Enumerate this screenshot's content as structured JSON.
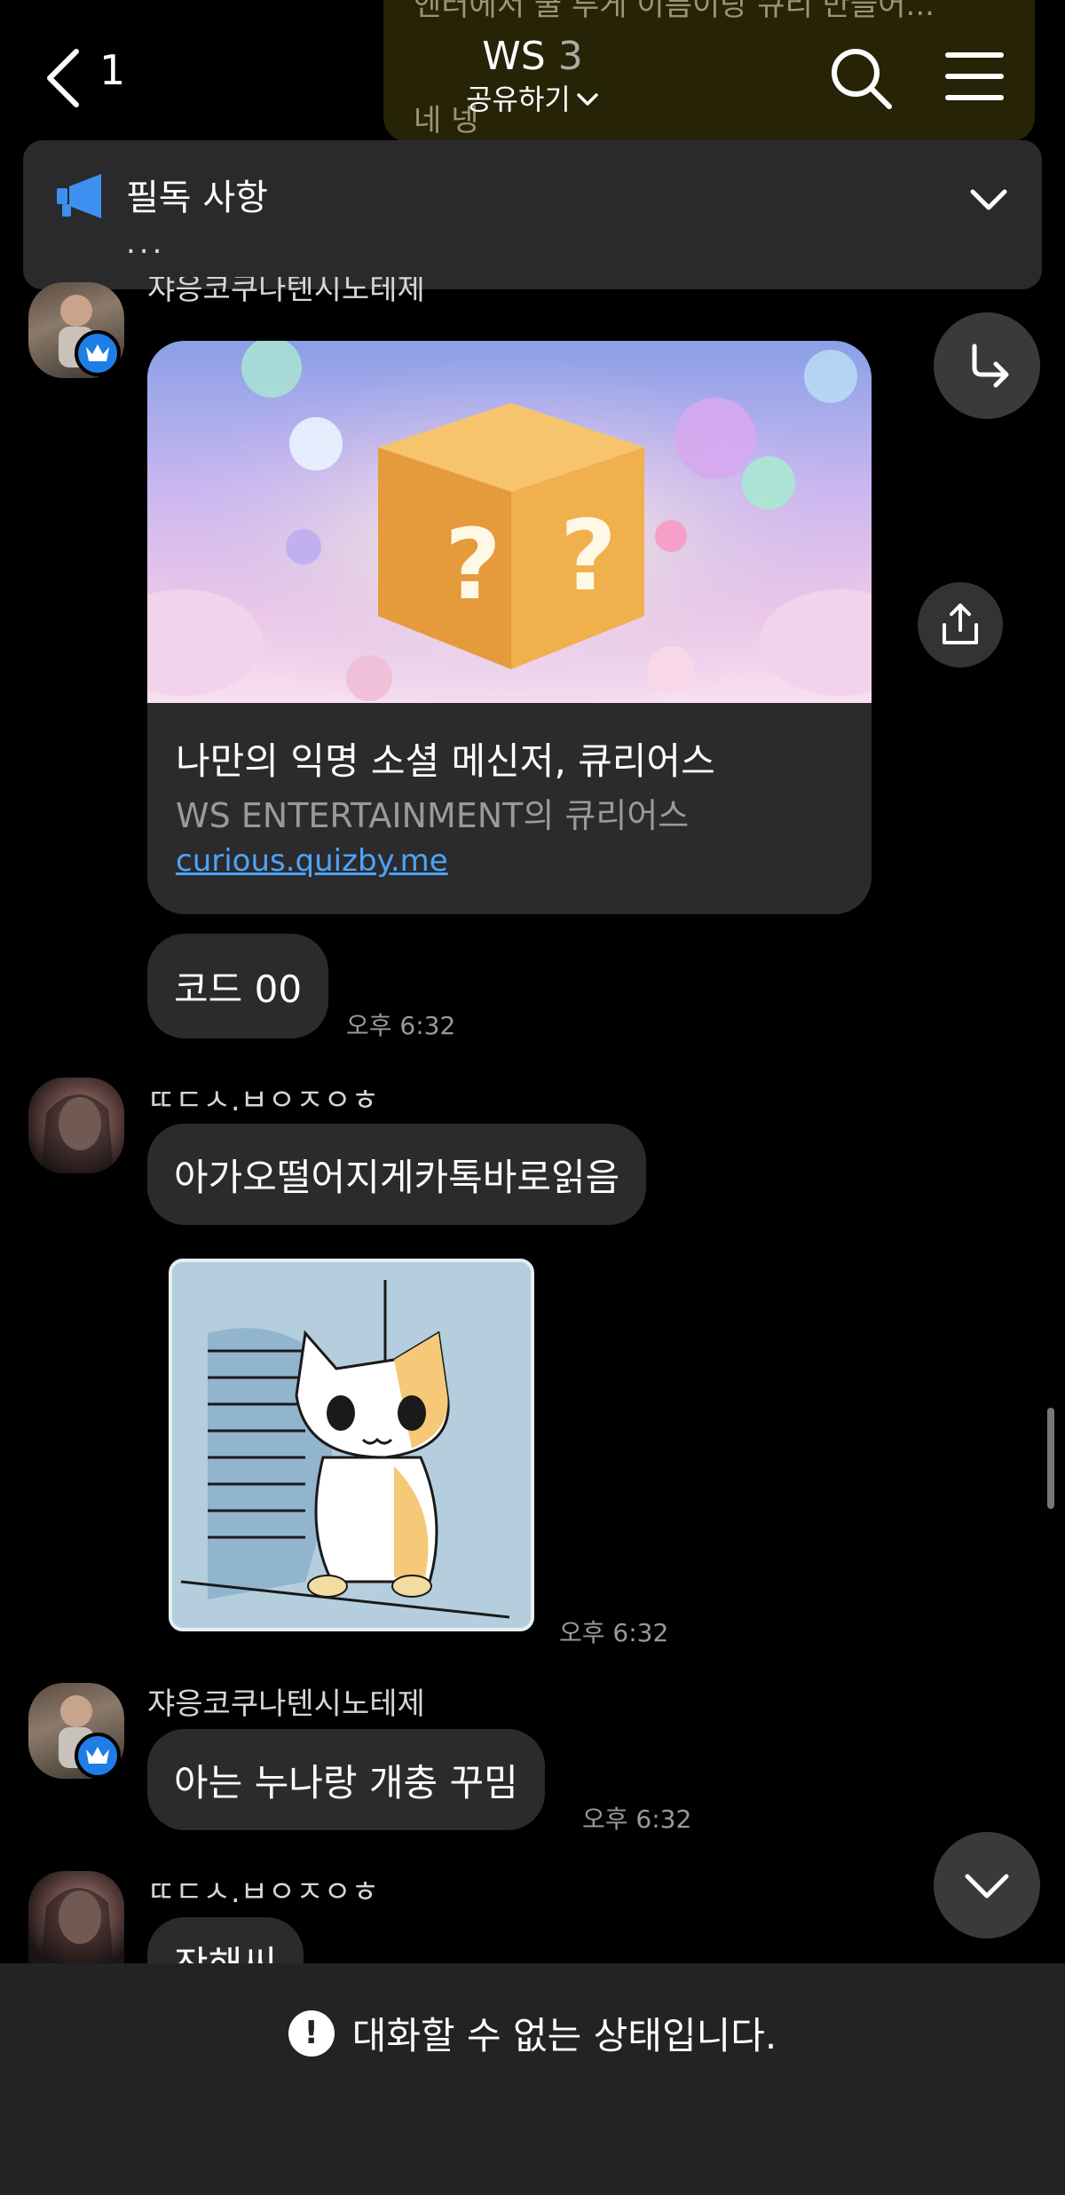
{
  "top_message": {
    "line1": "엔터에서 쿨 투게 이름이랑 큐리 만들어...",
    "line2": "네 넹"
  },
  "header": {
    "back_count": "1",
    "title": "WS",
    "member_count": "3",
    "share_label": "공유하기"
  },
  "notice": {
    "title": "필독 사항",
    "preview": "..."
  },
  "messages": {
    "sender_a_top": "쟈응코쿠나텐시노테제",
    "link_card": {
      "title": "나만의 익명 소셜 메신저, 큐리어스",
      "description": "WS ENTERTAINMENT의 큐리어스",
      "url": "curious.quizby.me"
    },
    "code_text": "코드 00",
    "time_1": "오후 6:32",
    "sender_b": "ㄸㄷㅅ.ㅂㅇㅈㅇㅎ",
    "msg_b1": "아가오떨어지게카톡바로읽음",
    "time_2": "오후 6:32",
    "sender_a": "쟈응코쿠나텐시노테제",
    "msg_a2": "아는 누나랑 개충 꾸밈",
    "time_3": "오후 6:32",
    "sender_b2": "ㄸㄷㅅ.ㅂㅇㅈㅇㅎ",
    "msg_b2_partial": "잔해씨"
  },
  "footer": {
    "blocked_text": "대화할 수 없는 상태입니다."
  },
  "colors": {
    "background": "#000000",
    "bubble": "#2b2b2d",
    "link": "#4fa3f7",
    "crown_badge": "#1e7ee6"
  },
  "icons": [
    "back-icon",
    "search-icon",
    "menu-icon",
    "megaphone-icon",
    "chevron-down-icon",
    "forward-icon",
    "share-icon",
    "crown-icon",
    "exclamation-icon"
  ]
}
